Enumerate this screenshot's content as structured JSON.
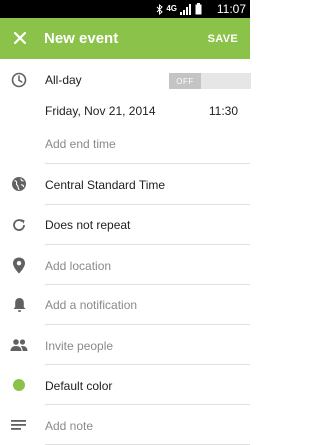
{
  "statusbar": {
    "time": "11:07",
    "network": "4G"
  },
  "toolbar": {
    "title": "New event",
    "save_label": "SAVE"
  },
  "allday": {
    "label": "All-day",
    "switch_state": "OFF"
  },
  "start": {
    "date": "Friday, Nov 21, 2014",
    "time": "11:30"
  },
  "end": {
    "placeholder": "Add end time"
  },
  "timezone": {
    "label": "Central Standard Time"
  },
  "repeat": {
    "label": "Does not repeat"
  },
  "location": {
    "placeholder": "Add location"
  },
  "notification": {
    "placeholder": "Add a notification"
  },
  "invite": {
    "placeholder": "Invite people"
  },
  "color": {
    "label": "Default color",
    "value": "#8bc34a"
  },
  "note": {
    "placeholder": "Add note"
  },
  "colors": {
    "accent": "#8bc34a",
    "icon": "#616161",
    "hint": "#8a8a8a",
    "text": "#212121"
  }
}
